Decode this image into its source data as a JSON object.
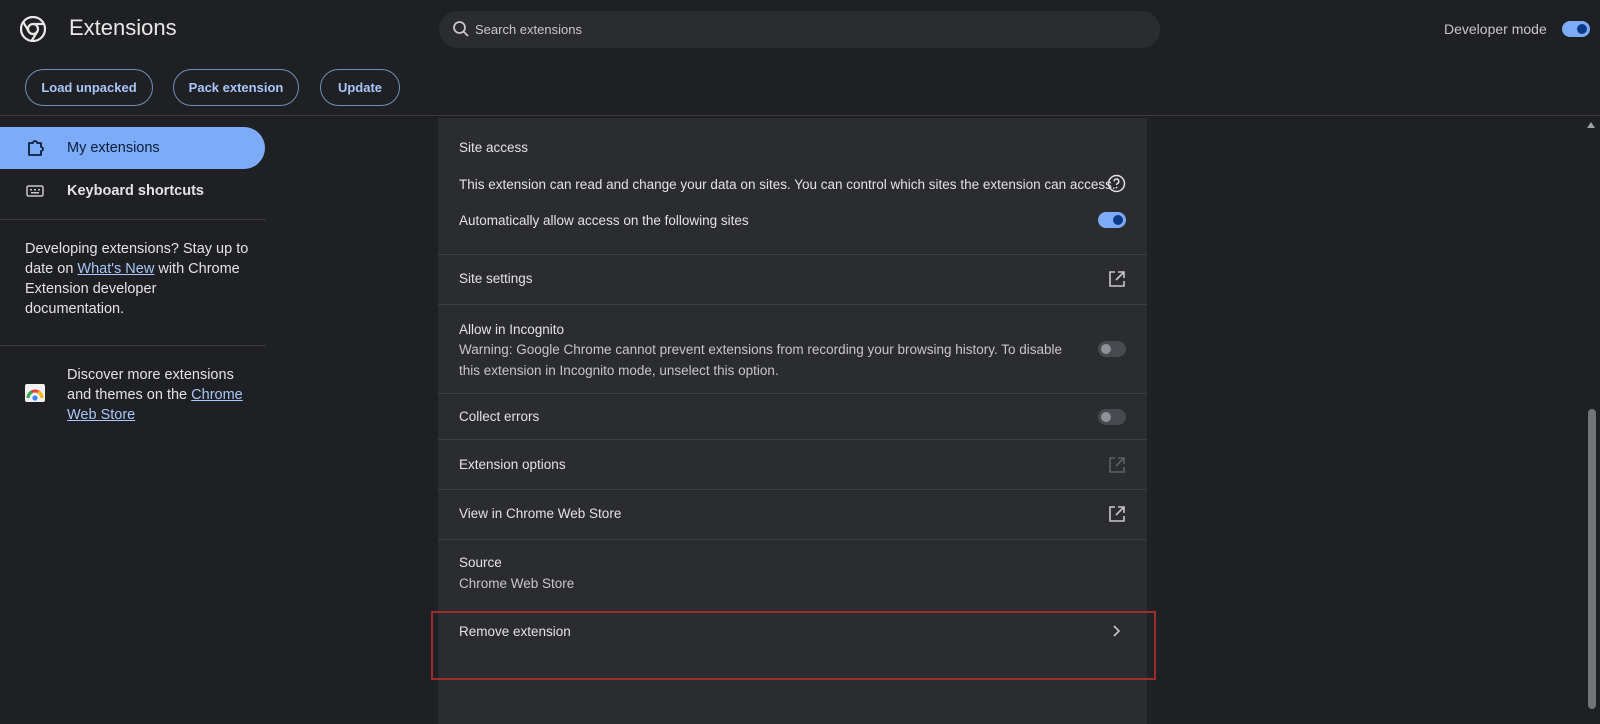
{
  "header": {
    "title": "Extensions",
    "search_placeholder": "Search extensions",
    "developer_mode_label": "Developer mode",
    "developer_mode_on": true,
    "buttons": {
      "load_unpacked": "Load unpacked",
      "pack_extension": "Pack extension",
      "update": "Update"
    }
  },
  "sidebar": {
    "items": [
      {
        "label": "My extensions",
        "icon": "puzzle-icon",
        "active": true
      },
      {
        "label": "Keyboard shortcuts",
        "icon": "keyboard-icon",
        "active": false
      }
    ],
    "dev_text": {
      "before": "Developing extensions? Stay up to date on ",
      "link": "What's New",
      "after": " with Chrome Extension developer documentation."
    },
    "store_text": {
      "before": "Discover more extensions and themes on the ",
      "link": "Chrome Web Store"
    }
  },
  "details": {
    "site_access": {
      "title": "Site access",
      "description": "This extension can read and change your data on sites. You can control which sites the extension can access.",
      "auto_allow_label": "Automatically allow access on the following sites",
      "auto_allow_on": true
    },
    "site_settings": {
      "label": "Site settings"
    },
    "incognito": {
      "title": "Allow in Incognito",
      "warning": "Warning: Google Chrome cannot prevent extensions from recording your browsing history. To disable this extension in Incognito mode, unselect this option.",
      "on": false
    },
    "collect_errors": {
      "label": "Collect errors",
      "on": false
    },
    "extension_options": {
      "label": "Extension options"
    },
    "view_in_store": {
      "label": "View in Chrome Web Store"
    },
    "source": {
      "title": "Source",
      "value": "Chrome Web Store"
    },
    "remove": {
      "label": "Remove extension"
    }
  },
  "colors": {
    "accent": "#7cacf8",
    "link": "#a8c7fa",
    "highlight_border": "#a12b2b",
    "background": "#1f2023",
    "card": "#2b2c2f"
  }
}
